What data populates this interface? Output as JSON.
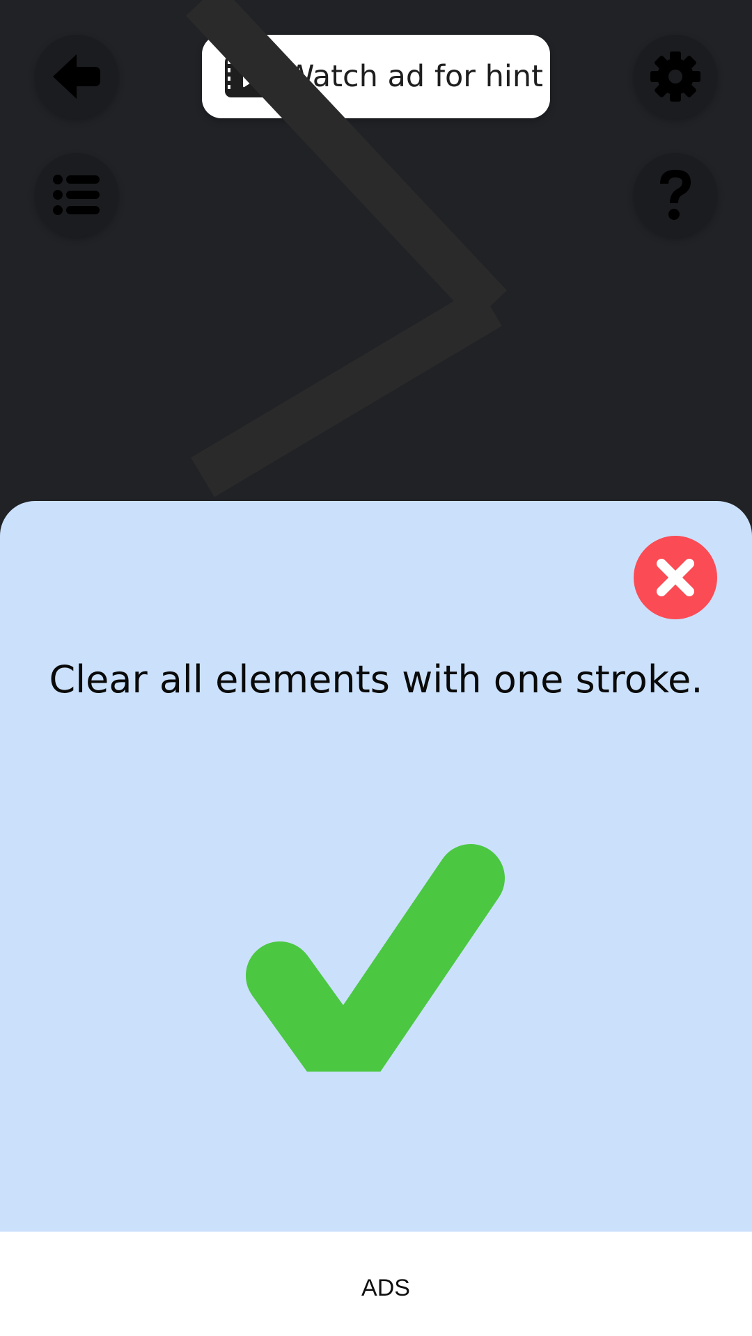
{
  "toolbar": {
    "hint_label": "Watch ad for hint",
    "back_icon": "arrow-left-icon",
    "settings_icon": "gear-icon",
    "levels_icon": "list-icon",
    "help_icon": "question-mark-icon",
    "hint_icon": "film-play-icon"
  },
  "result_panel": {
    "message": "Clear all elements with one stroke.",
    "close_icon": "close-icon",
    "status_icon": "checkmark-icon"
  },
  "ad": {
    "label": "ADS"
  },
  "colors": {
    "background": "#202226",
    "panel": "#cbe1fb",
    "close": "#fb4b54",
    "success": "#4bc742",
    "button_dark": "#1b1c1f"
  }
}
